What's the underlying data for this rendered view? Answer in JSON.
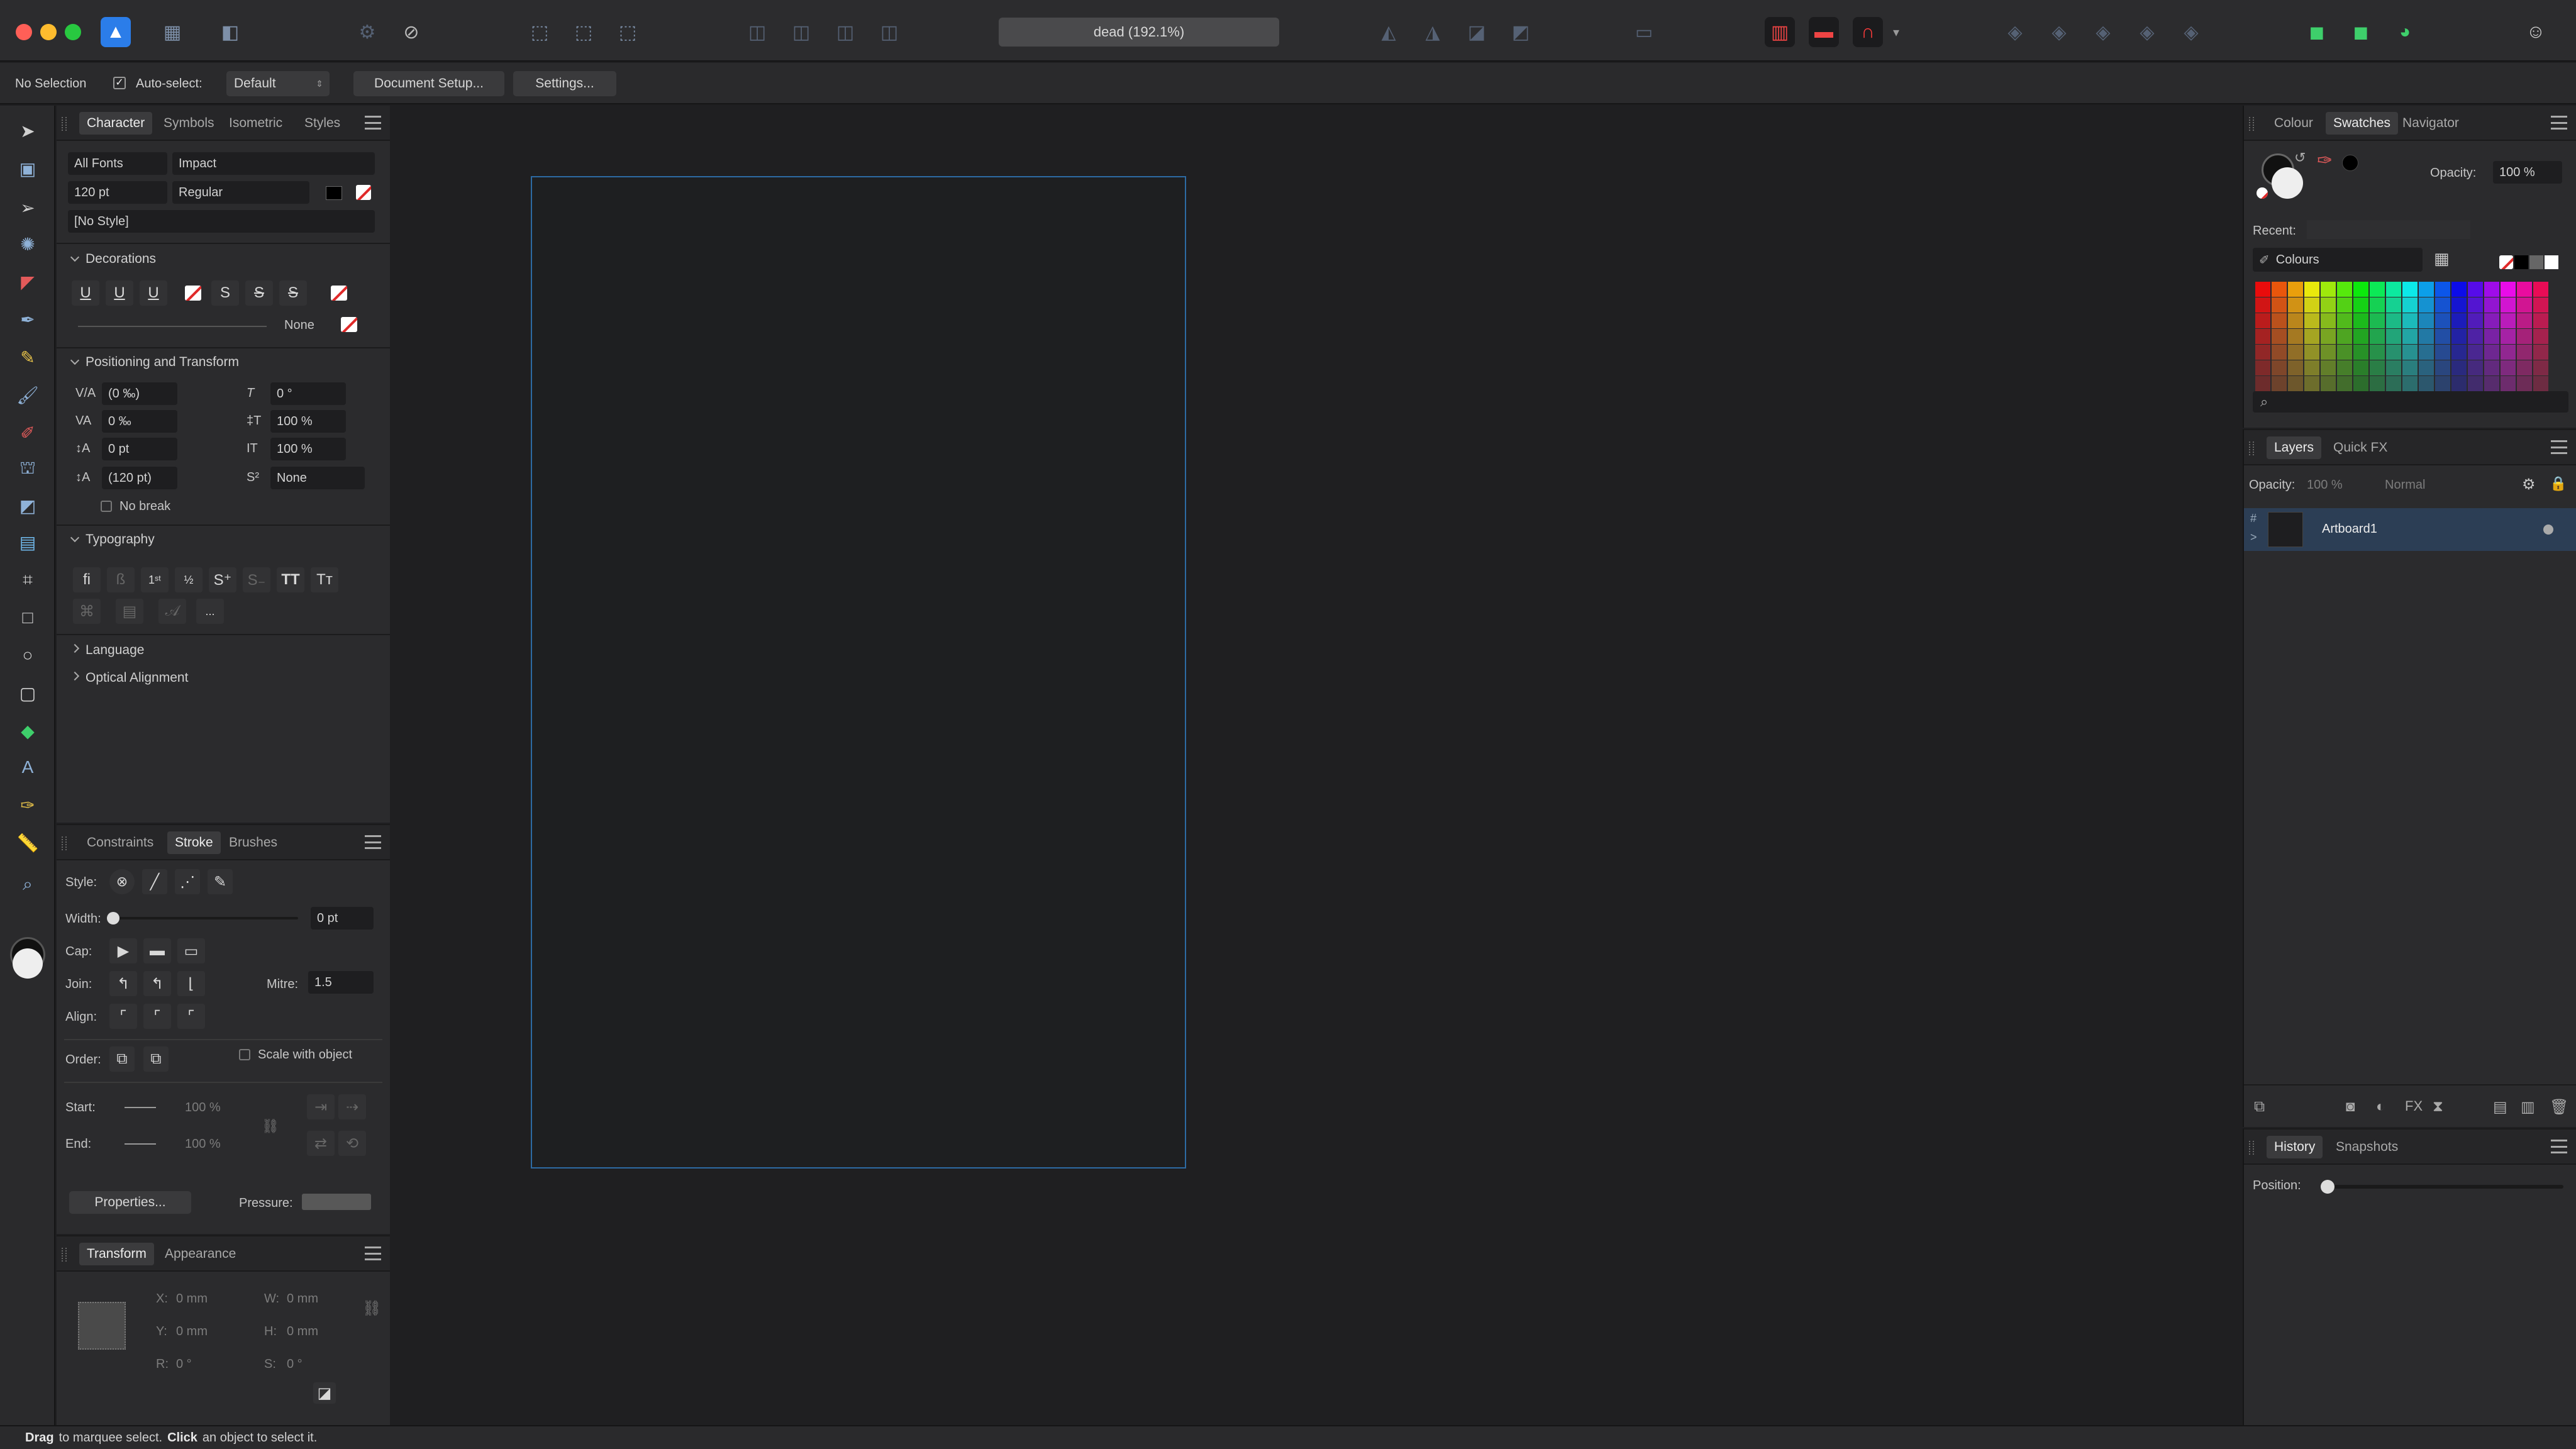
{
  "window": {
    "title": "dead (192.1%)"
  },
  "context_bar": {
    "selection": "No Selection",
    "auto_select_label": "Auto-select:",
    "auto_select_value": "Default",
    "document_setup": "Document Setup...",
    "settings": "Settings..."
  },
  "character_panel": {
    "tabs": [
      "Character",
      "Symbols",
      "Isometric",
      "Styles"
    ],
    "font_collection": "All Fonts",
    "font_family": "Impact",
    "font_size": "120 pt",
    "font_style": "Regular",
    "text_style": "[No Style]",
    "decorations": {
      "title": "Decorations",
      "line_value": "None"
    },
    "positioning": {
      "title": "Positioning and Transform",
      "kerning": "(0 ‰)",
      "tracking": "0 ‰",
      "baseline": "0 pt",
      "leading": "(120 pt)",
      "shear": "0 °",
      "vert_scale": "100 %",
      "horiz_scale": "100 %",
      "script": "None",
      "no_break": "No break"
    },
    "typography": {
      "title": "Typography",
      "more": "..."
    },
    "language": "Language",
    "optical_alignment": "Optical Alignment"
  },
  "stroke_panel": {
    "tabs": [
      "Constraints",
      "Stroke",
      "Brushes"
    ],
    "style_label": "Style:",
    "width_label": "Width:",
    "width_value": "0 pt",
    "cap_label": "Cap:",
    "join_label": "Join:",
    "mitre_label": "Mitre:",
    "mitre_value": "1.5",
    "align_label": "Align:",
    "order_label": "Order:",
    "scale_with_object": "Scale with object",
    "start_label": "Start:",
    "start_value": "100 %",
    "end_label": "End:",
    "end_value": "100 %",
    "properties": "Properties...",
    "pressure_label": "Pressure:"
  },
  "transform_panel": {
    "tabs": [
      "Transform",
      "Appearance"
    ],
    "x_label": "X:",
    "x_value": "0 mm",
    "y_label": "Y:",
    "y_value": "0 mm",
    "w_label": "W:",
    "w_value": "0 mm",
    "h_label": "H:",
    "h_value": "0 mm",
    "r_label": "R:",
    "r_value": "0 °",
    "s_label": "S:",
    "s_value": "0 °"
  },
  "swatches_panel": {
    "tabs": [
      "Colour",
      "Swatches",
      "Navigator"
    ],
    "opacity_label": "Opacity:",
    "opacity_value": "100 %",
    "recent_label": "Recent:",
    "palette": "Colours"
  },
  "layers_panel": {
    "tabs": [
      "Layers",
      "Quick FX"
    ],
    "opacity_label": "Opacity:",
    "opacity_value": "100 %",
    "blend_mode": "Normal",
    "layers": [
      {
        "name": "Artboard1"
      }
    ]
  },
  "history_panel": {
    "tabs": [
      "History",
      "Snapshots"
    ],
    "position_label": "Position:"
  },
  "status_bar": {
    "drag": "Drag",
    "drag_text": "to marquee select.",
    "click": "Click",
    "click_text": "an object to select it."
  },
  "colors": {
    "accent": "#2d6aa3",
    "selected_layer": "#2c3e55",
    "panel": "#2b2b2d",
    "canvas": "#1f1f21"
  },
  "icons": {
    "toolbar": [
      "designer-persona-icon",
      "pixel-persona-icon",
      "export-persona-icon",
      "gear-icon",
      "snapping-icon"
    ],
    "tools": [
      "move-tool-icon",
      "artboard-tool-icon",
      "node-tool-icon",
      "point-transform-icon",
      "corner-tool-icon",
      "pen-tool-icon",
      "pencil-tool-icon",
      "vector-brush-icon",
      "paint-brush-icon",
      "fill-tool-icon",
      "transparency-tool-icon",
      "place-image-icon",
      "crop-tool-icon",
      "rectangle-tool-icon",
      "ellipse-tool-icon",
      "rounded-rect-icon",
      "shape-tool-icon",
      "text-tool-icon",
      "color-picker-icon",
      "measure-tool-icon",
      "zoom-tool-icon"
    ]
  }
}
